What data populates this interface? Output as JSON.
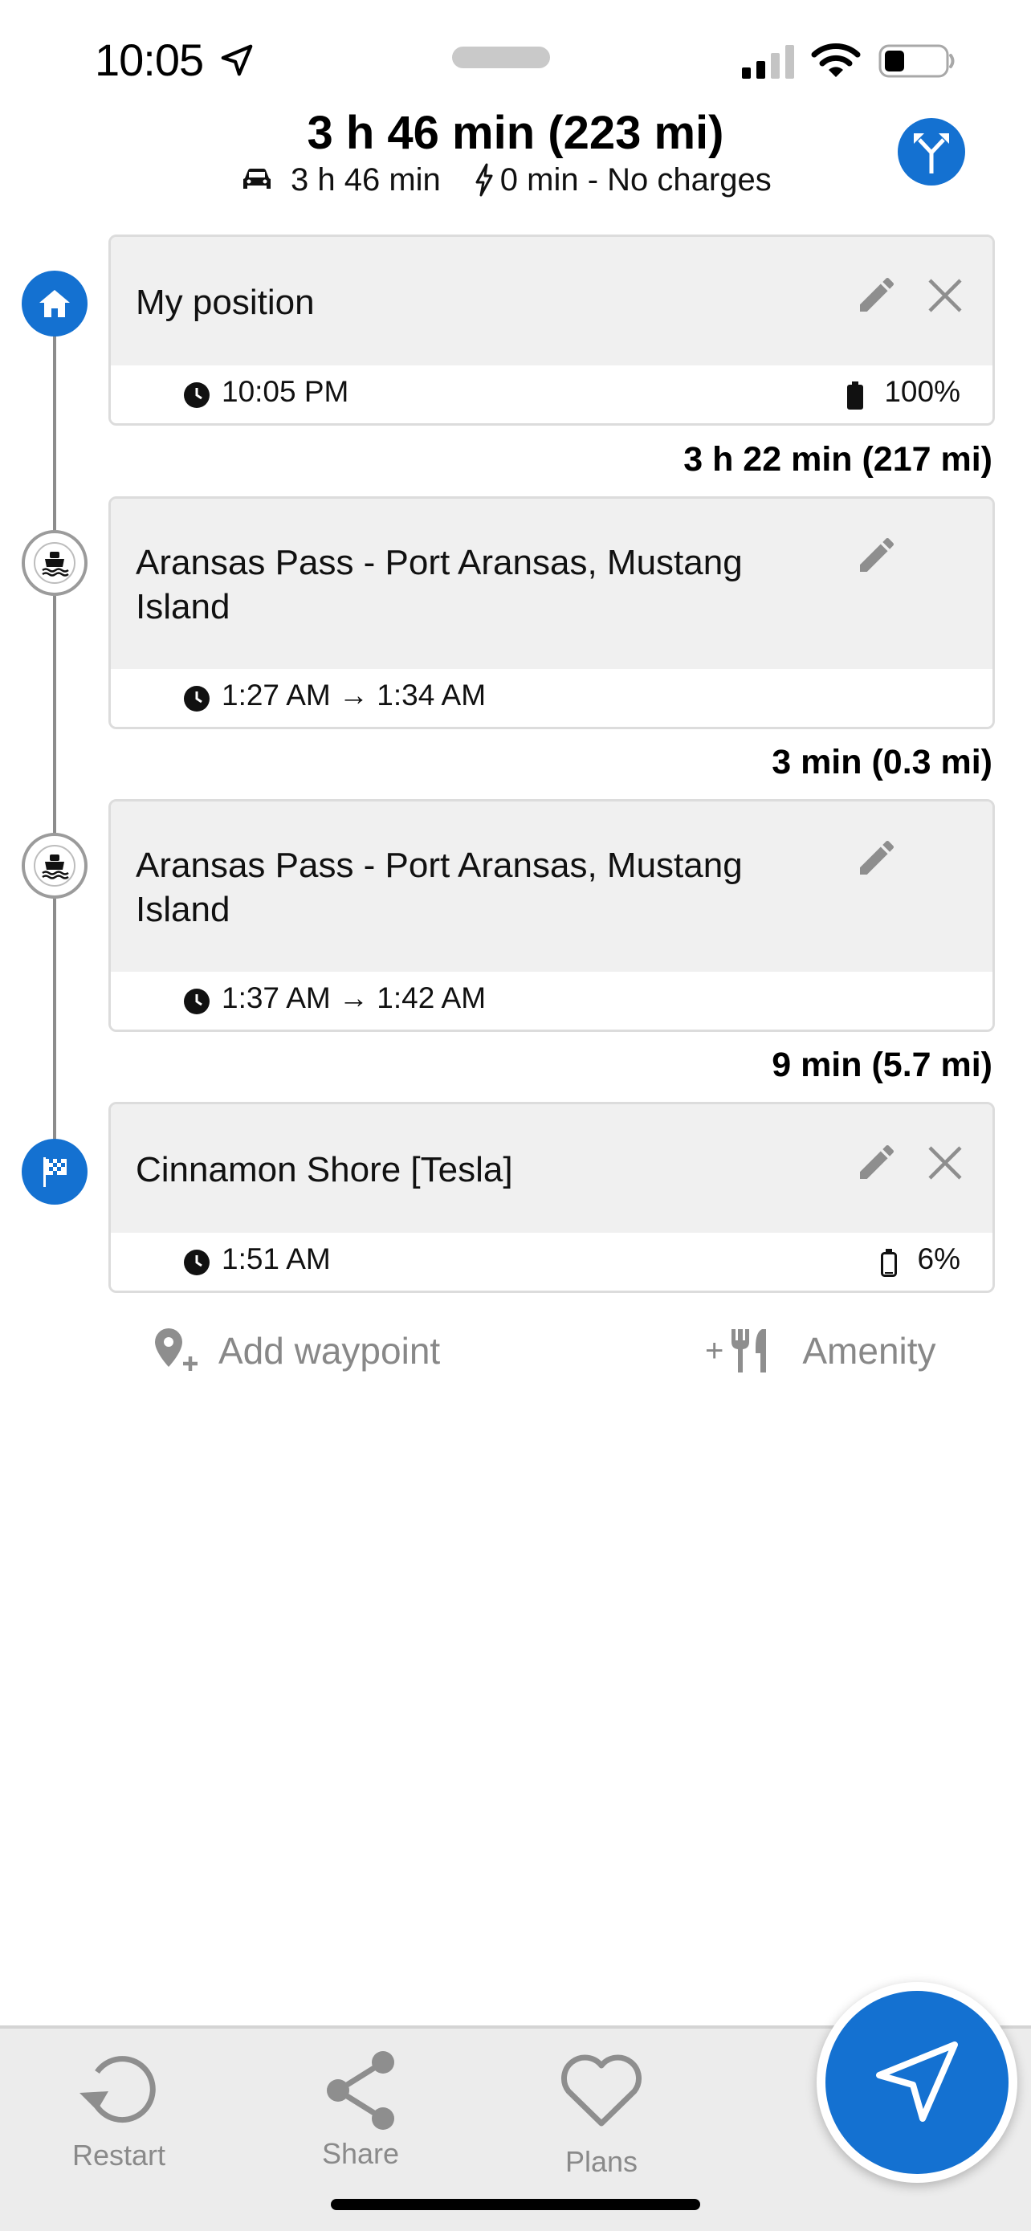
{
  "status_bar": {
    "time": "10:05"
  },
  "header": {
    "title": "3 h 46 min (223 mi)",
    "drive_time": "3 h 46 min",
    "charge_summary": "0 min - No charges"
  },
  "waypoints": [
    {
      "name": "My position",
      "time": "10:05 PM",
      "battery": "100%",
      "type": "start"
    },
    {
      "name": "Aransas Pass - Port Aransas, Mustang Island",
      "time": "1:27 AM → 1:34 AM",
      "type": "ferry"
    },
    {
      "name": "Aransas Pass - Port Aransas, Mustang Island",
      "time": "1:37 AM → 1:42 AM",
      "type": "ferry"
    },
    {
      "name": "Cinnamon Shore [Tesla]",
      "time": "1:51 AM",
      "battery": "6%",
      "type": "destination"
    }
  ],
  "segments": [
    "3 h 22 min (217 mi)",
    "3 min (0.3 mi)",
    "9 min (5.7 mi)"
  ],
  "actions": {
    "add_waypoint": "Add waypoint",
    "amenity": "Amenity",
    "amenity_prefix": "+"
  },
  "bottom_bar": {
    "restart": "Restart",
    "share": "Share",
    "plans": "Plans"
  },
  "colors": {
    "accent": "#1471d1",
    "card_head": "#f0f0f0",
    "muted": "#888888"
  },
  "icons": [
    "location-arrow-icon",
    "signal-icon",
    "wifi-icon",
    "battery-icon",
    "car-icon",
    "bolt-icon",
    "fork-route-icon",
    "home-icon",
    "ferry-icon",
    "flag-icon",
    "edit-icon",
    "close-icon",
    "clock-icon",
    "add-location-icon",
    "cutlery-icon",
    "restart-icon",
    "share-icon",
    "heart-icon",
    "navigation-arrow-icon"
  ]
}
